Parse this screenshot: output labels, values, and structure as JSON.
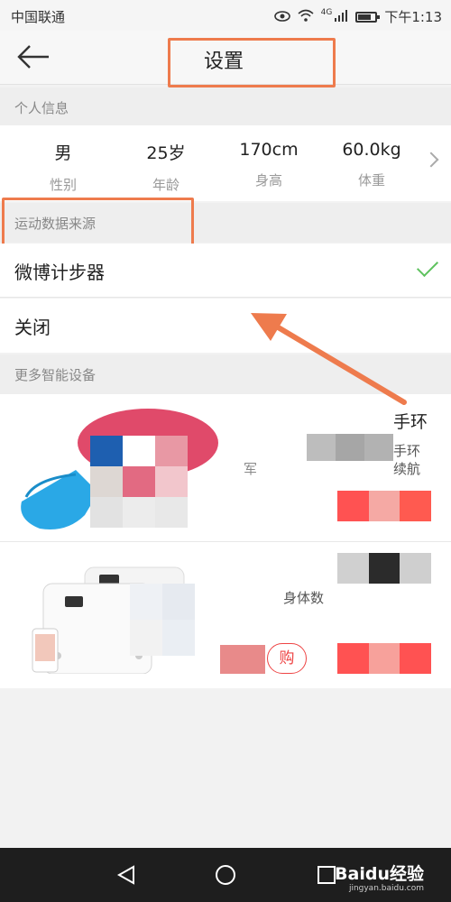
{
  "status_bar": {
    "carrier": "中国联通",
    "signal_tag": "4G",
    "time": "下午1:13"
  },
  "header": {
    "title": "设置"
  },
  "personal_section": {
    "header": "个人信息",
    "stats": [
      {
        "value": "男",
        "label": "性别"
      },
      {
        "value": "25岁",
        "label": "年龄"
      },
      {
        "value": "170cm",
        "label": "身高"
      },
      {
        "value": "60.0kg",
        "label": "体重"
      }
    ]
  },
  "source_section": {
    "header": "运动数据来源",
    "options": [
      {
        "label": "微博计步器",
        "selected": true
      },
      {
        "label": "关闭",
        "selected": false
      }
    ]
  },
  "devices_section": {
    "header": "更多智能设备",
    "devices": [
      {
        "title": "手环",
        "sub1": "手环",
        "sub2": "续航",
        "side_text": "军"
      },
      {
        "sub": "身体数",
        "buy_label": "购"
      }
    ]
  },
  "colors": {
    "highlight": "#ee7b4d",
    "check": "#5ec25e",
    "accent_red": "#ff5252"
  },
  "watermark": {
    "brand": "Baidu经验",
    "site": "jingyan.baidu.com"
  }
}
